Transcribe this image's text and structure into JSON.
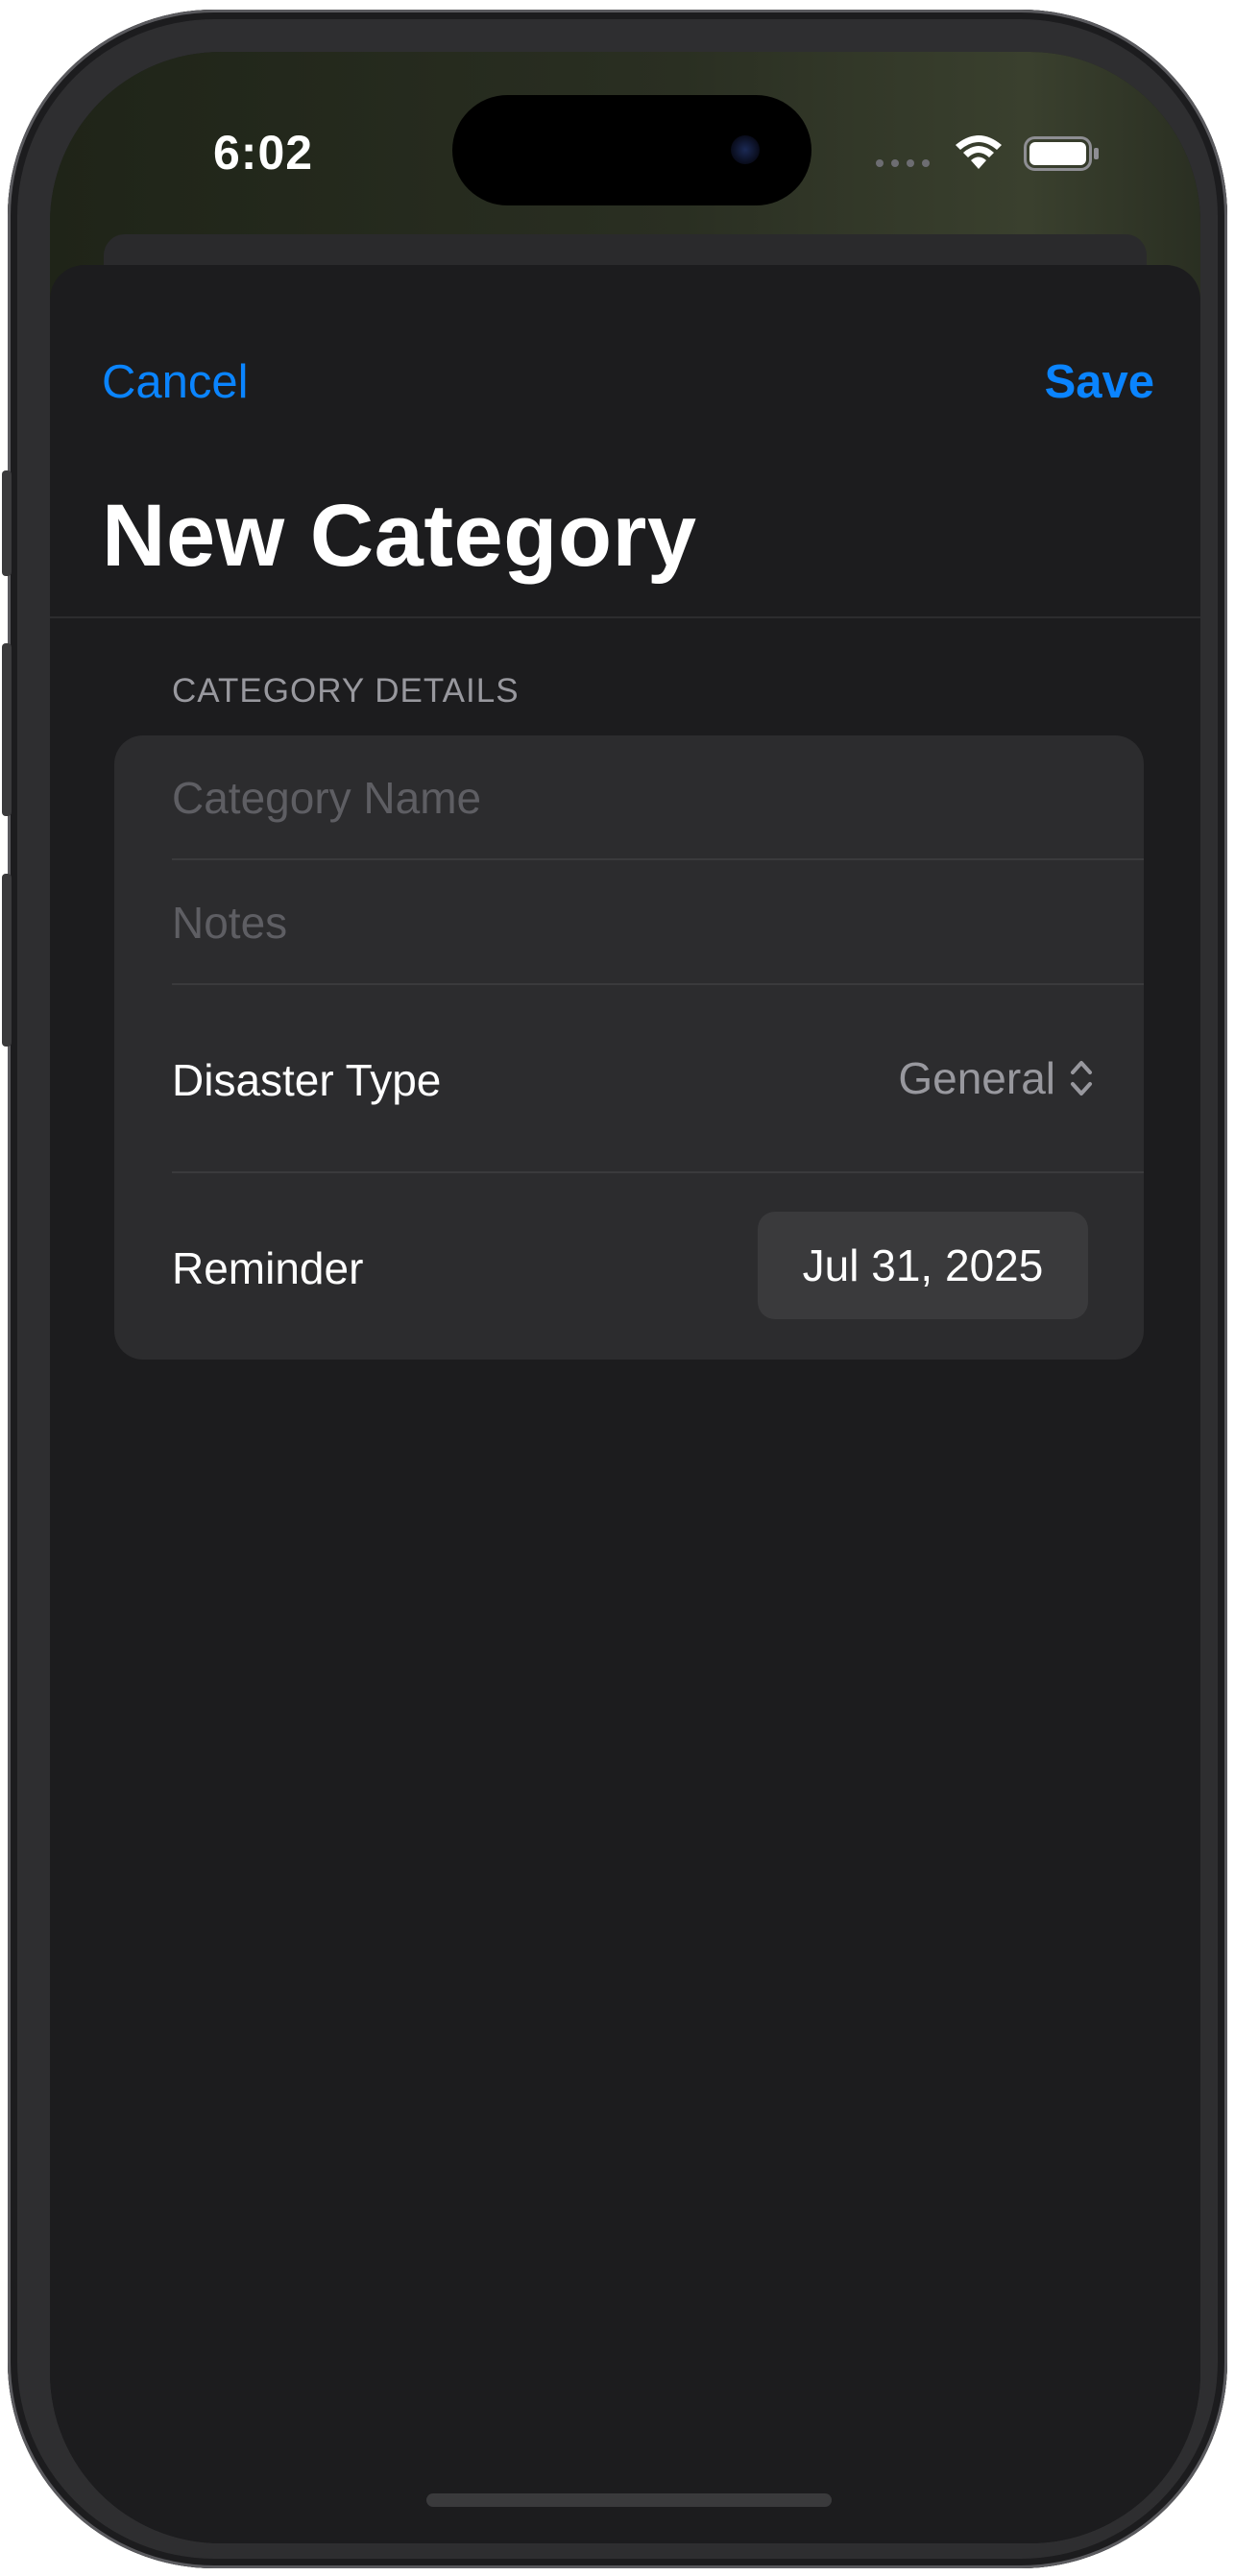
{
  "status_bar": {
    "time": "6:02"
  },
  "nav": {
    "cancel_label": "Cancel",
    "save_label": "Save"
  },
  "page_title": "New Category",
  "section": {
    "header": "CATEGORY DETAILS",
    "category_name_placeholder": "Category Name",
    "category_name_value": "",
    "notes_placeholder": "Notes",
    "notes_value": "",
    "disaster_type_label": "Disaster Type",
    "disaster_type_value": "General",
    "reminder_label": "Reminder",
    "reminder_value": "Jul 31, 2025"
  },
  "colors": {
    "accent": "#0a84ff",
    "background": "#1c1c1e",
    "group_background": "#2c2c2e",
    "secondary_text": "#98989e"
  },
  "icons": [
    "wifi-icon",
    "battery-icon",
    "chevron-updown-icon"
  ]
}
